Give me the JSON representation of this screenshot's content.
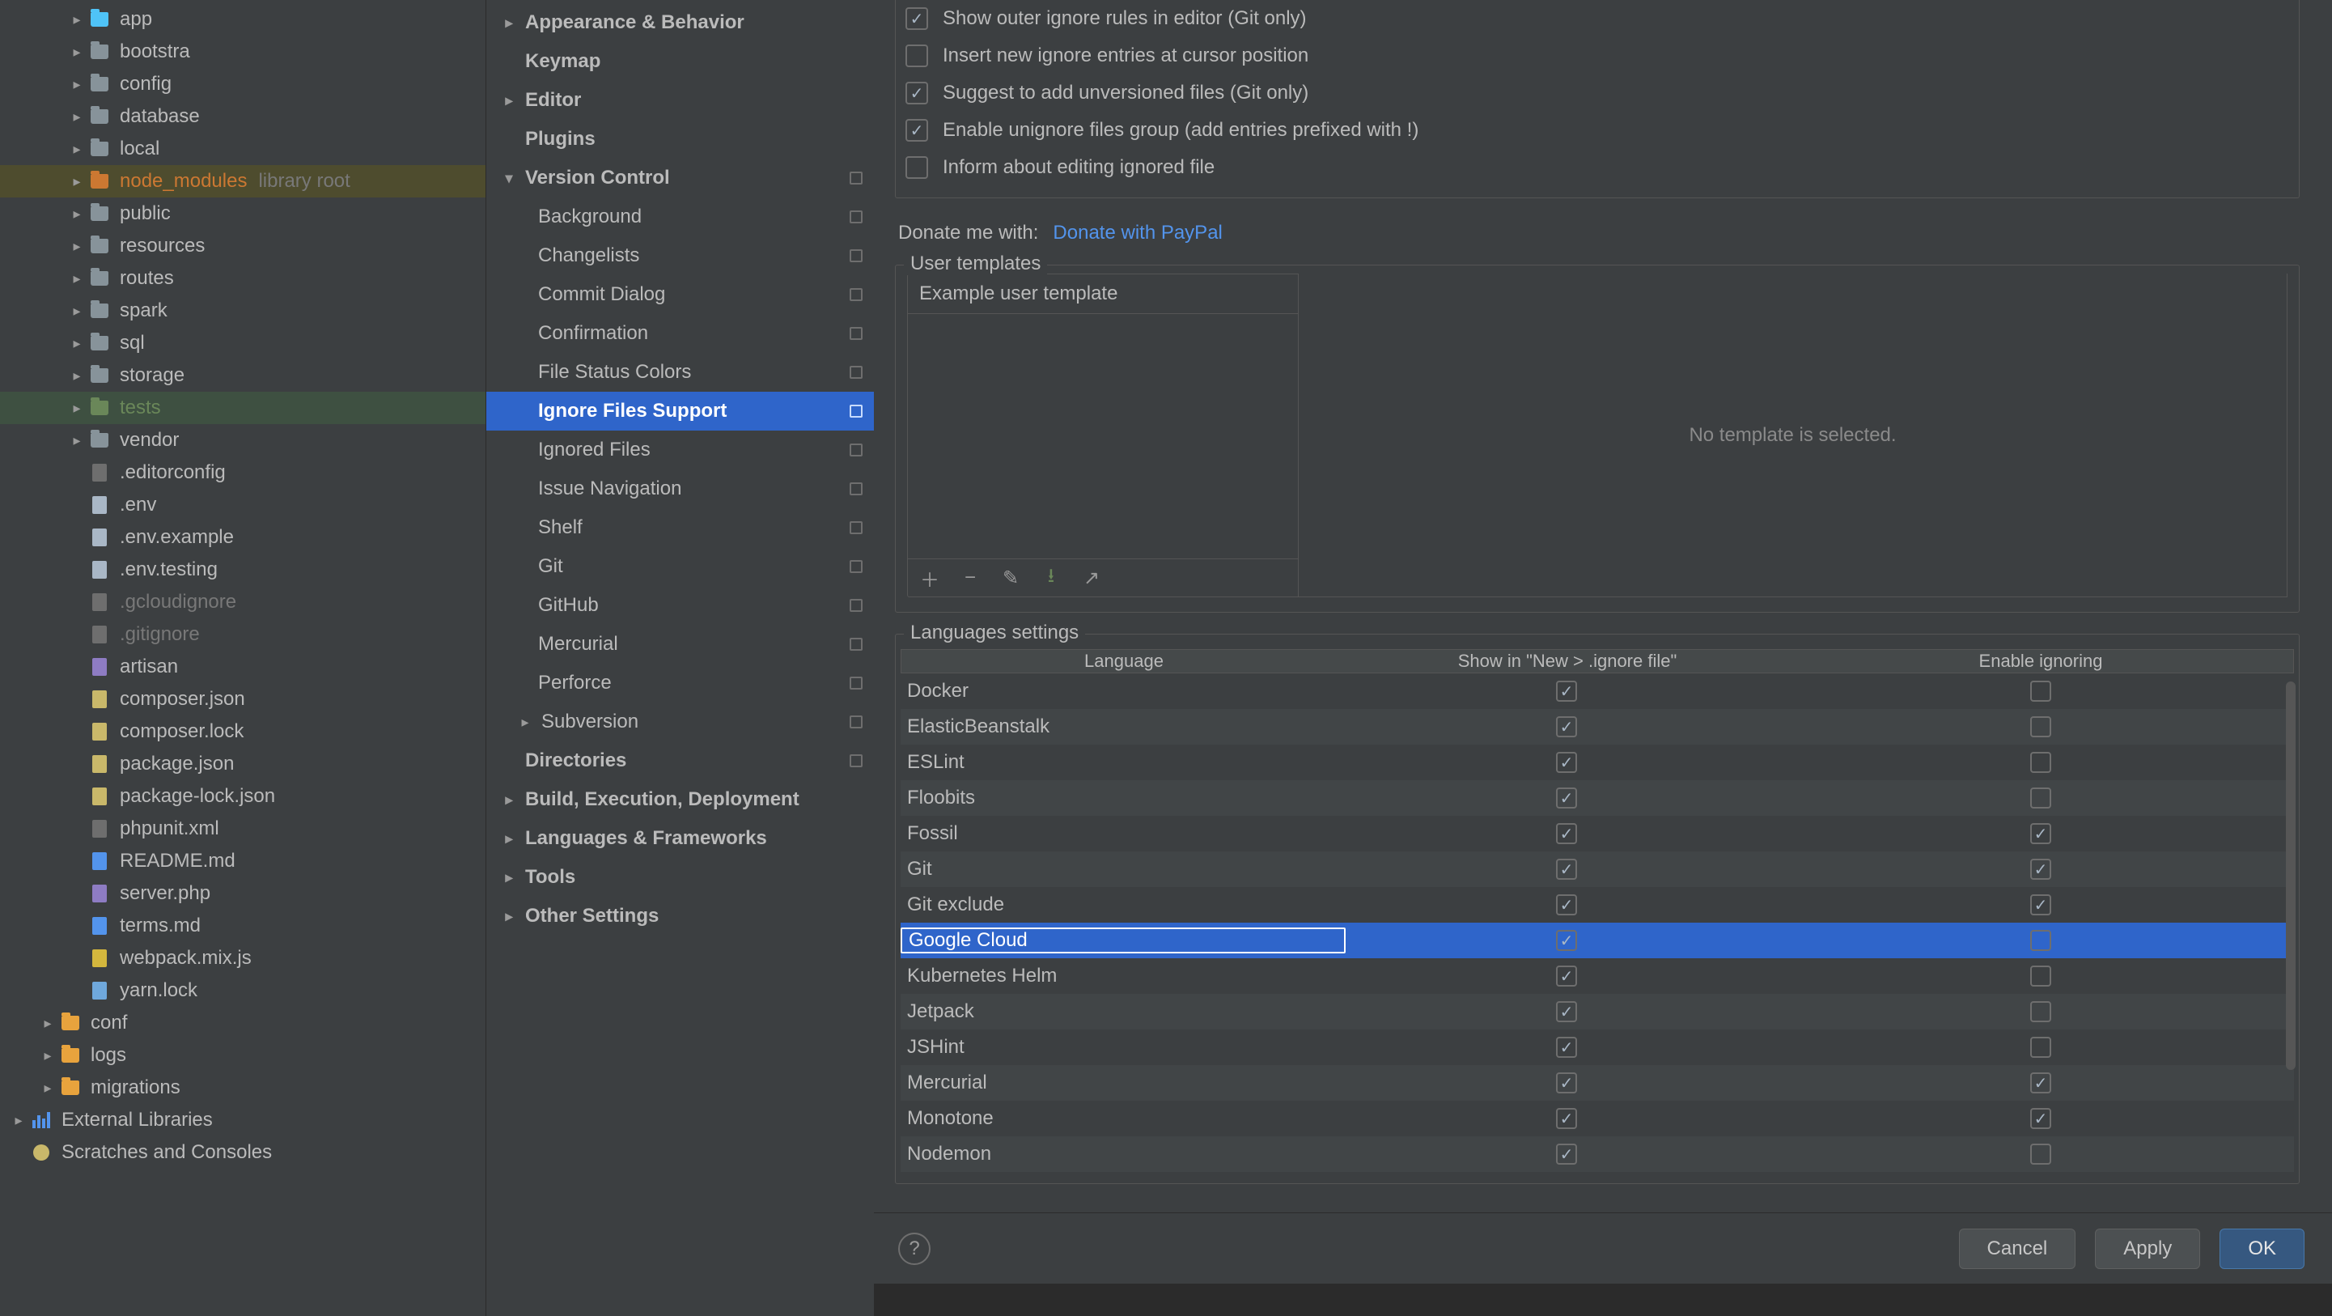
{
  "tree": [
    {
      "d": 2,
      "tw": "r",
      "ic": "folder cyan",
      "t": "app"
    },
    {
      "d": 2,
      "tw": "r",
      "ic": "folder",
      "t": "bootstra"
    },
    {
      "d": 2,
      "tw": "r",
      "ic": "folder",
      "t": "config"
    },
    {
      "d": 2,
      "tw": "r",
      "ic": "folder",
      "t": "database"
    },
    {
      "d": 2,
      "tw": "r",
      "ic": "folder",
      "t": "local"
    },
    {
      "d": 2,
      "tw": "r",
      "ic": "folder yellow",
      "t": "node_modules",
      "hint": "library root",
      "cls": "orange",
      "sel": "orange"
    },
    {
      "d": 2,
      "tw": "r",
      "ic": "folder",
      "t": "public"
    },
    {
      "d": 2,
      "tw": "r",
      "ic": "folder",
      "t": "resources"
    },
    {
      "d": 2,
      "tw": "r",
      "ic": "folder",
      "t": "routes"
    },
    {
      "d": 2,
      "tw": "r",
      "ic": "folder",
      "t": "spark"
    },
    {
      "d": 2,
      "tw": "r",
      "ic": "folder",
      "t": "sql"
    },
    {
      "d": 2,
      "tw": "r",
      "ic": "folder",
      "t": "storage"
    },
    {
      "d": 2,
      "tw": "r",
      "ic": "folder green",
      "t": "tests",
      "cls": "green",
      "sel": "green"
    },
    {
      "d": 2,
      "tw": "r",
      "ic": "folder",
      "t": "vendor"
    },
    {
      "d": 2,
      "tw": "",
      "ic": "file gear",
      "t": ".editorconfig"
    },
    {
      "d": 2,
      "tw": "",
      "ic": "file",
      "t": ".env"
    },
    {
      "d": 2,
      "tw": "",
      "ic": "file",
      "t": ".env.example"
    },
    {
      "d": 2,
      "tw": "",
      "ic": "file",
      "t": ".env.testing"
    },
    {
      "d": 2,
      "tw": "",
      "ic": "file gear",
      "t": ".gcloudignore",
      "cls": "dim"
    },
    {
      "d": 2,
      "tw": "",
      "ic": "file gear",
      "t": ".gitignore",
      "cls": "dim"
    },
    {
      "d": 2,
      "tw": "",
      "ic": "file php",
      "t": "artisan"
    },
    {
      "d": 2,
      "tw": "",
      "ic": "file json",
      "t": "composer.json"
    },
    {
      "d": 2,
      "tw": "",
      "ic": "file json",
      "t": "composer.lock"
    },
    {
      "d": 2,
      "tw": "",
      "ic": "file json",
      "t": "package.json"
    },
    {
      "d": 2,
      "tw": "",
      "ic": "file json",
      "t": "package-lock.json"
    },
    {
      "d": 2,
      "tw": "",
      "ic": "file gear",
      "t": "phpunit.xml"
    },
    {
      "d": 2,
      "tw": "",
      "ic": "file md",
      "t": "README.md"
    },
    {
      "d": 2,
      "tw": "",
      "ic": "file php",
      "t": "server.php"
    },
    {
      "d": 2,
      "tw": "",
      "ic": "file md",
      "t": "terms.md"
    },
    {
      "d": 2,
      "tw": "",
      "ic": "file js",
      "t": "webpack.mix.js"
    },
    {
      "d": 2,
      "tw": "",
      "ic": "file lock",
      "t": "yarn.lock"
    },
    {
      "d": 1,
      "tw": "r",
      "ic": "folder orange",
      "t": "conf"
    },
    {
      "d": 1,
      "tw": "r",
      "ic": "folder orange",
      "t": "logs"
    },
    {
      "d": 1,
      "tw": "r",
      "ic": "folder orange",
      "t": "migrations"
    },
    {
      "d": 0,
      "tw": "r",
      "ic": "bars",
      "t": "External Libraries"
    },
    {
      "d": 0,
      "tw": "",
      "ic": "scr",
      "t": "Scratches and Consoles"
    }
  ],
  "cats": [
    {
      "type": "top",
      "tw": "r",
      "t": "Appearance & Behavior"
    },
    {
      "type": "top",
      "tw": "",
      "t": "Keymap"
    },
    {
      "type": "top",
      "tw": "r",
      "t": "Editor"
    },
    {
      "type": "top",
      "tw": "",
      "t": "Plugins"
    },
    {
      "type": "top",
      "tw": "d",
      "t": "Version Control",
      "sq": true
    },
    {
      "type": "sub",
      "t": "Background",
      "sq": true
    },
    {
      "type": "sub",
      "t": "Changelists",
      "sq": true
    },
    {
      "type": "sub",
      "t": "Commit Dialog",
      "sq": true
    },
    {
      "type": "sub",
      "t": "Confirmation",
      "sq": true
    },
    {
      "type": "sub",
      "t": "File Status Colors",
      "sq": true
    },
    {
      "type": "sub",
      "t": "Ignore Files Support",
      "sq": true,
      "sel": true
    },
    {
      "type": "sub",
      "t": "Ignored Files",
      "sq": true
    },
    {
      "type": "sub",
      "t": "Issue Navigation",
      "sq": true
    },
    {
      "type": "sub",
      "t": "Shelf",
      "sq": true
    },
    {
      "type": "sub",
      "t": "Git",
      "sq": true
    },
    {
      "type": "sub",
      "t": "GitHub",
      "sq": true
    },
    {
      "type": "sub",
      "t": "Mercurial",
      "sq": true
    },
    {
      "type": "sub",
      "t": "Perforce",
      "sq": true
    },
    {
      "type": "sub",
      "tw": "r",
      "t": "Subversion",
      "sq": true
    },
    {
      "type": "top",
      "tw": "",
      "t": "Directories",
      "sq": true
    },
    {
      "type": "top",
      "tw": "r",
      "t": "Build, Execution, Deployment"
    },
    {
      "type": "top",
      "tw": "r",
      "t": "Languages & Frameworks"
    },
    {
      "type": "top",
      "tw": "r",
      "t": "Tools"
    },
    {
      "type": "top",
      "tw": "r",
      "t": "Other Settings"
    }
  ],
  "checks": [
    {
      "on": true,
      "t": "Show outer ignore rules in editor (Git only)"
    },
    {
      "on": false,
      "t": "Insert new ignore entries at cursor position"
    },
    {
      "on": true,
      "t": "Suggest to add unversioned files (Git only)"
    },
    {
      "on": true,
      "t": "Enable unignore files group (add entries prefixed with !)"
    },
    {
      "on": false,
      "t": "Inform about editing ignored file"
    }
  ],
  "donate_label": "Donate me with:",
  "donate_link": "Donate with PayPal",
  "user_templates_title": "User templates",
  "user_template_item": "Example user template",
  "no_template": "No template is selected.",
  "lang_title": "Languages settings",
  "th": {
    "l": "Language",
    "s": "Show in \"New > .ignore file\"",
    "e": "Enable ignoring"
  },
  "rows": [
    {
      "l": "Docker",
      "s": true,
      "e": false
    },
    {
      "l": "ElasticBeanstalk",
      "s": true,
      "e": false
    },
    {
      "l": "ESLint",
      "s": true,
      "e": false
    },
    {
      "l": "Floobits",
      "s": true,
      "e": false
    },
    {
      "l": "Fossil",
      "s": true,
      "e": true
    },
    {
      "l": "Git",
      "s": true,
      "e": true
    },
    {
      "l": "Git exclude",
      "s": true,
      "e": true
    },
    {
      "l": "Google Cloud",
      "s": true,
      "e": false,
      "sel": true
    },
    {
      "l": "Kubernetes Helm",
      "s": true,
      "e": false
    },
    {
      "l": "Jetpack",
      "s": true,
      "e": false
    },
    {
      "l": "JSHint",
      "s": true,
      "e": false
    },
    {
      "l": "Mercurial",
      "s": true,
      "e": true
    },
    {
      "l": "Monotone",
      "s": true,
      "e": true
    },
    {
      "l": "Nodemon",
      "s": true,
      "e": false
    }
  ],
  "btn": {
    "cancel": "Cancel",
    "apply": "Apply",
    "ok": "OK"
  }
}
